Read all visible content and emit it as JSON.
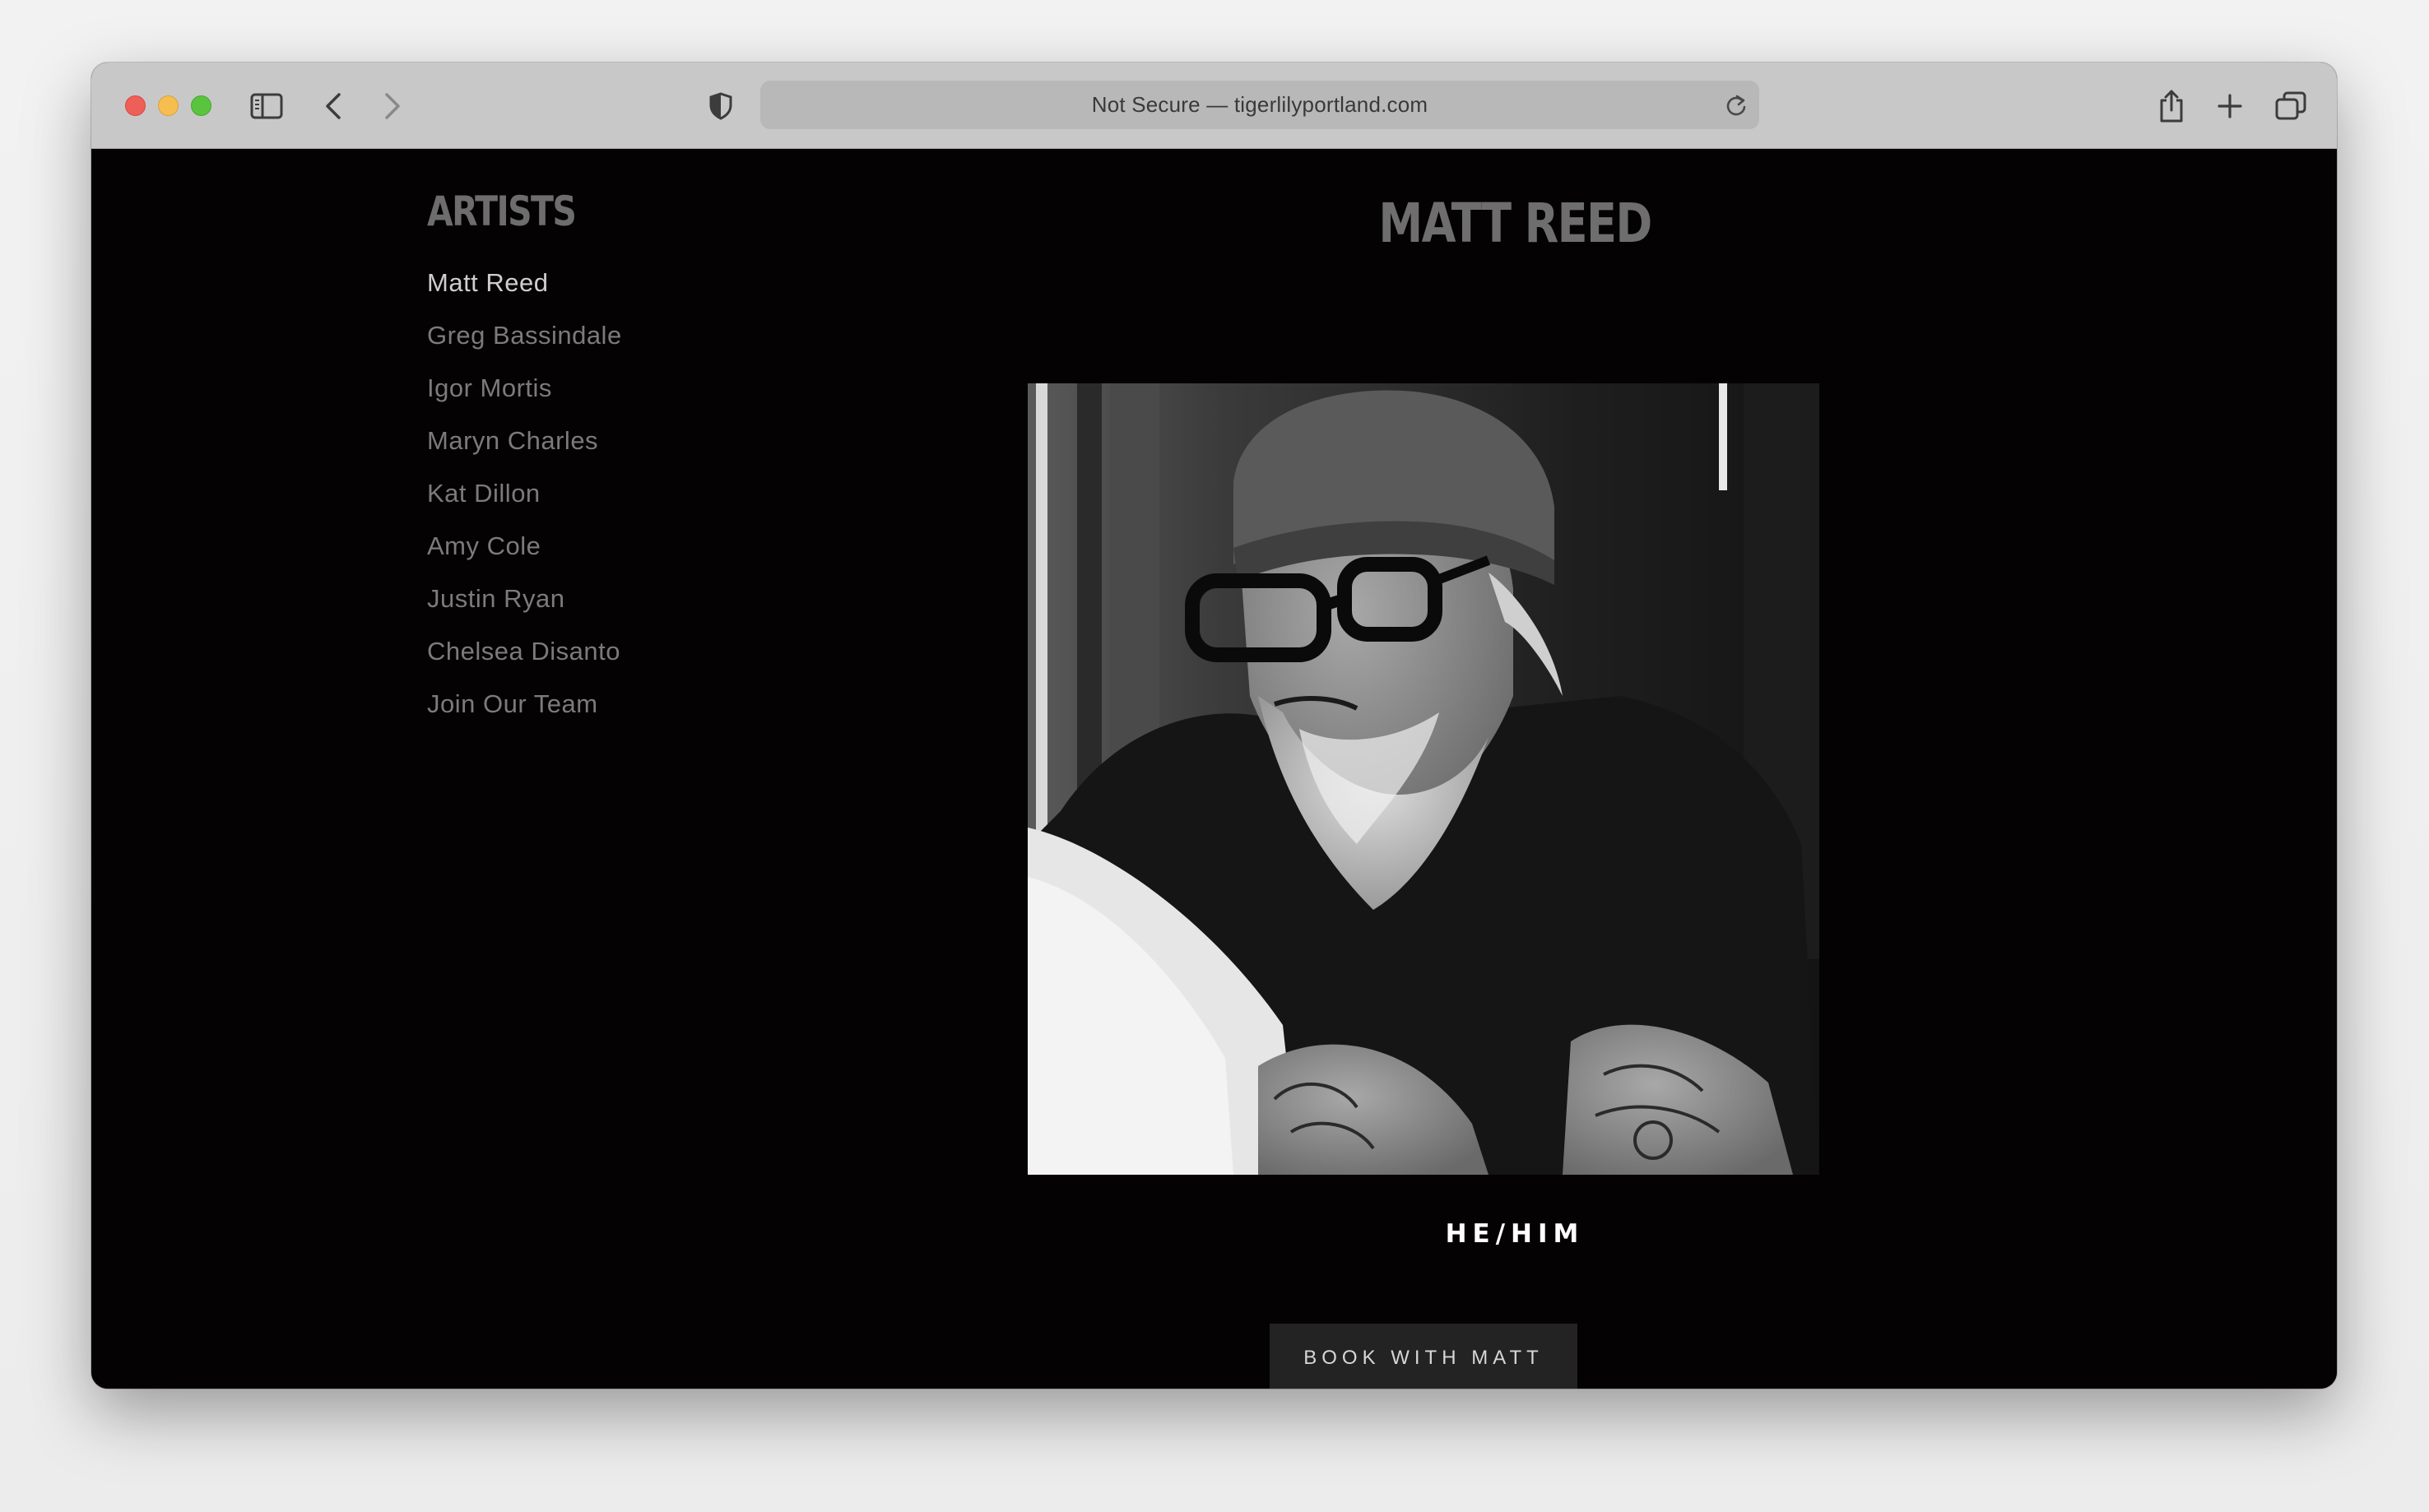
{
  "browser": {
    "address_text": "Not Secure — tigerlilyportland.com",
    "icons": [
      "sidebar-icon",
      "back-icon",
      "forward-icon",
      "shield-icon",
      "reload-icon",
      "share-icon",
      "new-tab-icon",
      "tabs-overview-icon"
    ]
  },
  "sidebar": {
    "title": "ARTISTS",
    "items": [
      {
        "label": "Matt Reed",
        "active": true
      },
      {
        "label": "Greg Bassindale"
      },
      {
        "label": "Igor Mortis"
      },
      {
        "label": "Maryn Charles"
      },
      {
        "label": "Kat Dillon"
      },
      {
        "label": "Amy Cole"
      },
      {
        "label": "Justin Ryan"
      },
      {
        "label": "Chelsea Disanto"
      },
      {
        "label": "Join Our Team"
      }
    ]
  },
  "main": {
    "title": "MATT REED",
    "pronouns": "HE/HIM",
    "book_button": "BOOK WITH MATT"
  },
  "colors": {
    "page_background": "#040203",
    "toolbar_background": "#c9c8c9",
    "heading_gray": "#6f6e6f",
    "link_gray": "#7c7b7c",
    "button_background": "#242324"
  }
}
